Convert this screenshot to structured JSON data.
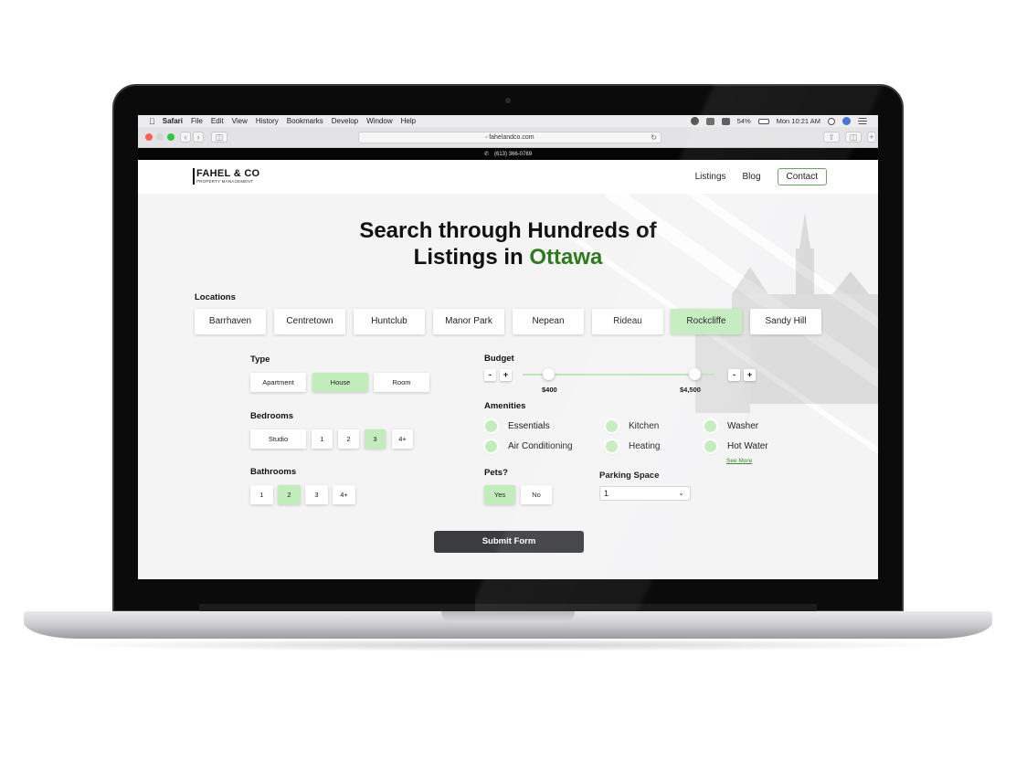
{
  "menubar": {
    "app": "Safari",
    "items": [
      "File",
      "Edit",
      "View",
      "History",
      "Bookmarks",
      "Develop",
      "Window",
      "Help"
    ],
    "battery": "54%",
    "clock": "Mon 10:21 AM"
  },
  "browser": {
    "url": "fahelandco.com"
  },
  "topbar": {
    "phone": "(613) 366-0769"
  },
  "header": {
    "logo_main": "FAHEL & CO",
    "logo_sub": "PROPERTY MANAGEMENT",
    "nav": [
      "Listings",
      "Blog",
      "Contact"
    ]
  },
  "hero": {
    "title_line1": "Search through Hundreds of",
    "title_line2_prefix": "Listings in ",
    "title_city": "Ottawa",
    "accent_color": "#2f7a1f"
  },
  "locations": {
    "label": "Locations",
    "items": [
      "Barrhaven",
      "Centretown",
      "Huntclub",
      "Manor Park",
      "Nepean",
      "Rideau",
      "Rockcliffe",
      "Sandy Hill"
    ],
    "selected": "Rockcliffe"
  },
  "type": {
    "label": "Type",
    "options": [
      "Apartment",
      "House",
      "Room"
    ],
    "selected": "House"
  },
  "bedrooms": {
    "label": "Bedrooms",
    "options": [
      "Studio",
      "1",
      "2",
      "3",
      "4+"
    ],
    "selected": "3"
  },
  "bathrooms": {
    "label": "Bathrooms",
    "options": [
      "1",
      "2",
      "3",
      "4+"
    ],
    "selected": "2"
  },
  "budget": {
    "label": "Budget",
    "min": "$400",
    "max": "$4,500",
    "minus": "-",
    "plus": "+"
  },
  "amenities": {
    "label": "Amenities",
    "items": [
      "Essentials",
      "Kitchen",
      "Washer",
      "Air Conditioning",
      "Heating",
      "Hot Water"
    ],
    "see_more": "See More"
  },
  "pets": {
    "label": "Pets?",
    "options": [
      "Yes",
      "No"
    ],
    "selected": "Yes"
  },
  "parking": {
    "label": "Parking Space",
    "value": "1"
  },
  "form": {
    "submit": "Submit Form"
  },
  "colors": {
    "selected_bg": "#c3ecbd",
    "contact_border": "#5fa35b",
    "submit_bg": "#3b3c40"
  }
}
